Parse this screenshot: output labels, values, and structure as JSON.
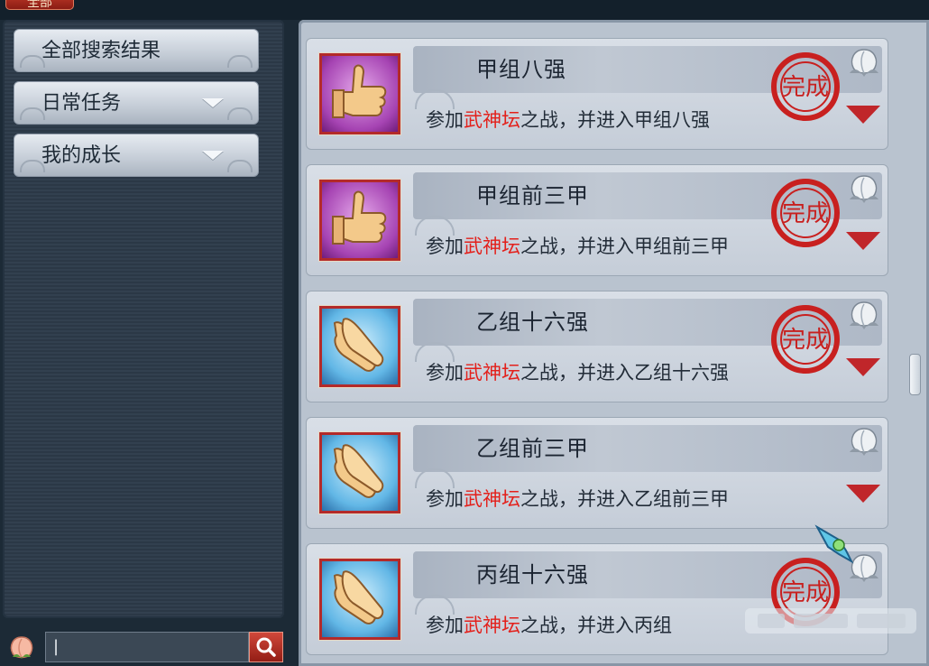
{
  "top_tab": {
    "label": "全部"
  },
  "sidebar": {
    "items": [
      {
        "label": "全部搜索结果",
        "expandable": false
      },
      {
        "label": "日常任务",
        "expandable": true
      },
      {
        "label": "我的成长",
        "expandable": true
      }
    ]
  },
  "search": {
    "value": "|",
    "icon": "search-icon"
  },
  "achievements": [
    {
      "title": "甲组八强",
      "desc_prefix": "参加",
      "desc_highlight": "武神坛",
      "desc_suffix": "之战，并进入甲组八强",
      "icon": "thumbs-up-icon",
      "icon_color": "purple",
      "completed": true,
      "stamp": "完成"
    },
    {
      "title": "甲组前三甲",
      "desc_prefix": "参加",
      "desc_highlight": "武神坛",
      "desc_suffix": "之战，并进入甲组前三甲",
      "icon": "thumbs-up-icon",
      "icon_color": "purple",
      "completed": true,
      "stamp": "完成"
    },
    {
      "title": "乙组十六强",
      "desc_prefix": "参加",
      "desc_highlight": "武神坛",
      "desc_suffix": "之战，并进入乙组十六强",
      "icon": "clapping-hands-icon",
      "icon_color": "blue",
      "completed": true,
      "stamp": "完成"
    },
    {
      "title": "乙组前三甲",
      "desc_prefix": "参加",
      "desc_highlight": "武神坛",
      "desc_suffix": "之战，并进入乙组前三甲",
      "icon": "clapping-hands-icon",
      "icon_color": "blue",
      "completed": false,
      "stamp": ""
    },
    {
      "title": "丙组十六强",
      "desc_prefix": "参加",
      "desc_highlight": "武神坛",
      "desc_suffix": "之战，并进入丙组",
      "icon": "clapping-hands-icon",
      "icon_color": "blue",
      "completed": true,
      "stamp": "完成"
    }
  ],
  "colors": {
    "highlight": "#e3201b",
    "stamp_red": "#c8201f",
    "accent_red": "#c0262a"
  }
}
